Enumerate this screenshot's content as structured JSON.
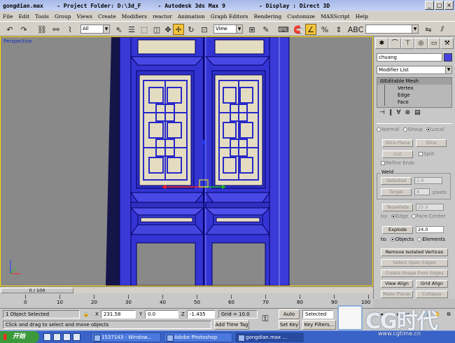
{
  "window": {
    "title": "gongdian.max    - Project Folder: D:\\3d_F     - Autodesk 3ds Max 9          - Display : Direct 3D",
    "controls": [
      "_",
      "□",
      "×"
    ]
  },
  "menu": [
    "File",
    "Edit",
    "Tools",
    "Group",
    "Views",
    "Create",
    "Modifiers",
    "reactor",
    "Animation",
    "Graph Editors",
    "Rendering",
    "Customize",
    "MAXScript",
    "Help"
  ],
  "toolbar": {
    "selection_filter": "All",
    "reference_coord": "View",
    "named_selection": ""
  },
  "viewport": {
    "label": "Perspective",
    "door_color": "#3a3ad8",
    "panel_color": "#e4dcc0",
    "background": "#898989"
  },
  "command_panel": {
    "object_name": "chuang",
    "object_color": "#4840e0",
    "modifier_list_label": "Modifier List",
    "stack": {
      "root": "Editable Mesh",
      "subobjects": [
        "Vertex",
        "Edge",
        "Face"
      ]
    },
    "normal_radios": [
      "Normal",
      "Group",
      "Local"
    ],
    "buttons": {
      "slice_plane": "Slice Plane",
      "slice": "Slice",
      "cut": "Cut",
      "split": "Split",
      "refine_ends": "Refine Ends",
      "weld_group": "Weld",
      "weld_selected": "Selected",
      "weld_selected_value": "1.0",
      "weld_target": "Target",
      "weld_target_value": "4",
      "weld_pixels": "pixels",
      "tessellate": "Tessellate",
      "tessellate_value": "25.0",
      "tess_by": "by:",
      "tess_edge": "Edge",
      "tess_face_center": "Face-Center",
      "explode": "Explode",
      "explode_value": "24.0",
      "explode_to": "to:",
      "explode_objects": "Objects",
      "explode_elements": "Elements",
      "remove_isolated": "Remove Isolated Vertices",
      "select_open_edges": "Select Open Edges",
      "create_shape": "Create Shape from Edges",
      "view_align": "View Align",
      "grid_align": "Grid Align",
      "make_planar": "Make Planar",
      "collapse": "Collapse"
    }
  },
  "timeline": {
    "slider_label": "0 / 100",
    "ticks": [
      0,
      10,
      20,
      30,
      40,
      50,
      60,
      70,
      80,
      90,
      100
    ]
  },
  "status": {
    "selection": "1 Object Selected",
    "prompt": "Click and drag to select and move objects",
    "x_label": "X",
    "x": "231.58",
    "y_label": "Y",
    "y": "0.0",
    "z_label": "Z",
    "z": "-1.435",
    "grid": "Grid = 10.0",
    "add_time_tag": "Add Time Tag",
    "auto_key": "Auto Key",
    "set_key": "Set Key",
    "key_mode": "Selected",
    "key_filters": "Key Filters..."
  },
  "taskbar": {
    "start": "开始",
    "tasks": [
      "1537143 - Window...",
      "Adobe Photoshop",
      "gongdian.max ..."
    ]
  },
  "watermark": {
    "text": "CG时代",
    "url": "www.cgtime.cn"
  }
}
